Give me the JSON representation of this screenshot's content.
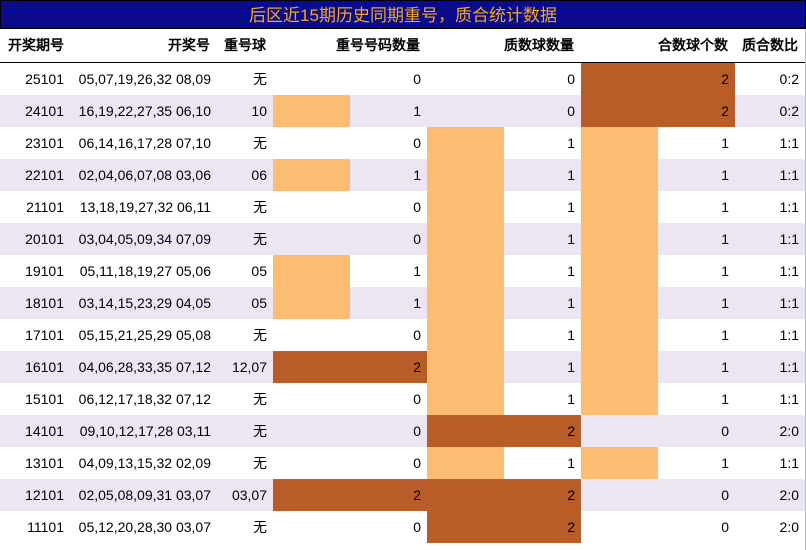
{
  "title": "后区近15期历史同期重号，质合统计数据",
  "headers": {
    "issue": "开奖期号",
    "numbers": "开奖号",
    "repeat_balls": "重号球",
    "repeat_count": "重号号码数量",
    "prime_count": "质数球数量",
    "composite_count": "合数球个数",
    "ratio": "质合数比"
  },
  "colors": {
    "light": "#fbbd72",
    "dark": "#b85c28",
    "row_alt": "#ece6f3",
    "title_bg": "#0a0a8c",
    "title_text": "#f5a623"
  },
  "rows": [
    {
      "issue": "25101",
      "numbers": "05,07,19,26,32 08,09",
      "repeat": "无",
      "repeat_count": "0",
      "prime": "0",
      "composite": "2",
      "ratio": "0:2"
    },
    {
      "issue": "24101",
      "numbers": "16,19,22,27,35 06,10",
      "repeat": "10",
      "repeat_count": "1",
      "prime": "0",
      "composite": "2",
      "ratio": "0:2"
    },
    {
      "issue": "23101",
      "numbers": "06,14,16,17,28 07,10",
      "repeat": "无",
      "repeat_count": "0",
      "prime": "1",
      "composite": "1",
      "ratio": "1:1"
    },
    {
      "issue": "22101",
      "numbers": "02,04,06,07,08 03,06",
      "repeat": "06",
      "repeat_count": "1",
      "prime": "1",
      "composite": "1",
      "ratio": "1:1"
    },
    {
      "issue": "21101",
      "numbers": "13,18,19,27,32 06,11",
      "repeat": "无",
      "repeat_count": "0",
      "prime": "1",
      "composite": "1",
      "ratio": "1:1"
    },
    {
      "issue": "20101",
      "numbers": "03,04,05,09,34 07,09",
      "repeat": "无",
      "repeat_count": "0",
      "prime": "1",
      "composite": "1",
      "ratio": "1:1"
    },
    {
      "issue": "19101",
      "numbers": "05,11,18,19,27 05,06",
      "repeat": "05",
      "repeat_count": "1",
      "prime": "1",
      "composite": "1",
      "ratio": "1:1"
    },
    {
      "issue": "18101",
      "numbers": "03,14,15,23,29 04,05",
      "repeat": "05",
      "repeat_count": "1",
      "prime": "1",
      "composite": "1",
      "ratio": "1:1"
    },
    {
      "issue": "17101",
      "numbers": "05,15,21,25,29 05,08",
      "repeat": "无",
      "repeat_count": "0",
      "prime": "1",
      "composite": "1",
      "ratio": "1:1"
    },
    {
      "issue": "16101",
      "numbers": "04,06,28,33,35 07,12",
      "repeat": "12,07",
      "repeat_count": "2",
      "prime": "1",
      "composite": "1",
      "ratio": "1:1"
    },
    {
      "issue": "15101",
      "numbers": "06,12,17,18,32 07,12",
      "repeat": "无",
      "repeat_count": "0",
      "prime": "1",
      "composite": "1",
      "ratio": "1:1"
    },
    {
      "issue": "14101",
      "numbers": "09,10,12,17,28 03,11",
      "repeat": "无",
      "repeat_count": "0",
      "prime": "2",
      "composite": "0",
      "ratio": "2:0"
    },
    {
      "issue": "13101",
      "numbers": "04,09,13,15,32 02,09",
      "repeat": "无",
      "repeat_count": "0",
      "prime": "1",
      "composite": "1",
      "ratio": "1:1"
    },
    {
      "issue": "12101",
      "numbers": "02,05,08,09,31 03,07",
      "repeat": "03,07",
      "repeat_count": "2",
      "prime": "2",
      "composite": "0",
      "ratio": "2:0"
    },
    {
      "issue": "11101",
      "numbers": "05,12,20,28,30 03,07",
      "repeat": "无",
      "repeat_count": "0",
      "prime": "2",
      "composite": "0",
      "ratio": "2:0"
    }
  ]
}
